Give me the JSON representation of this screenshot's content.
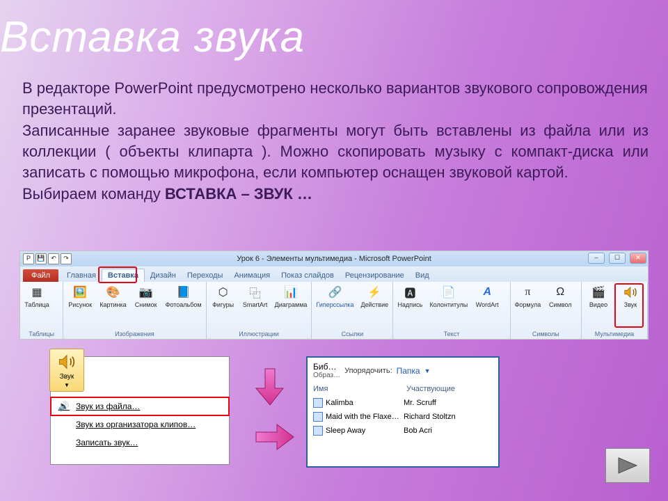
{
  "slide": {
    "title": "Вставка звука",
    "para1": "В редакторе PowerPoint предусмотрено несколько вариантов звукового сопровождения презентаций.",
    "para2": "Записанные заранее звуковые фрагменты могут быть вставлены из файла или из коллекции ( объекты клипарта ). Можно скопировать музыку с компакт-диска или записать с помощью микрофона, если компьютер оснащен звуковой картой.",
    "para3_prefix": "Выбираем команду ",
    "para3_cmd": "ВСТАВКА – ЗВУК …"
  },
  "ribbon": {
    "window_title": "Урок 6 - Элементы мультимедиа - Microsoft PowerPoint",
    "tabs": [
      "Файл",
      "Главная",
      "Вставка",
      "Дизайн",
      "Переходы",
      "Анимация",
      "Показ слайдов",
      "Рецензирование",
      "Вид"
    ],
    "groups": [
      {
        "title": "Таблицы",
        "buttons": [
          "Таблица"
        ]
      },
      {
        "title": "Изображения",
        "buttons": [
          "Рисунок",
          "Картинка",
          "Снимок",
          "Фотоальбом"
        ]
      },
      {
        "title": "Иллюстрации",
        "buttons": [
          "Фигуры",
          "SmartArt",
          "Диаграмма"
        ]
      },
      {
        "title": "Ссылки",
        "buttons": [
          "Гиперссылка",
          "Действие"
        ]
      },
      {
        "title": "Текст",
        "buttons": [
          "Надпись",
          "Колонтитулы",
          "WordArt"
        ]
      },
      {
        "title": "Символы",
        "buttons": [
          "Формула",
          "Символ"
        ]
      },
      {
        "title": "Мультимедиа",
        "buttons": [
          "Видео",
          "Звук"
        ]
      }
    ]
  },
  "dropdown": {
    "button_label": "Звук",
    "items": [
      "Звук из файла…",
      "Звук из организатора клипов…",
      "Записать звук…"
    ]
  },
  "library": {
    "title": "Биб…",
    "subtitle": "Образ…",
    "sort_label": "Упорядочить:",
    "sort_value": "Папка",
    "columns": [
      "Имя",
      "Участвующие"
    ],
    "rows": [
      {
        "name": "Kalimba",
        "artist": "Mr. Scruff"
      },
      {
        "name": "Maid with the Flaxe…",
        "artist": "Richard Stoltzn"
      },
      {
        "name": "Sleep Away",
        "artist": "Bob Acri"
      }
    ]
  }
}
